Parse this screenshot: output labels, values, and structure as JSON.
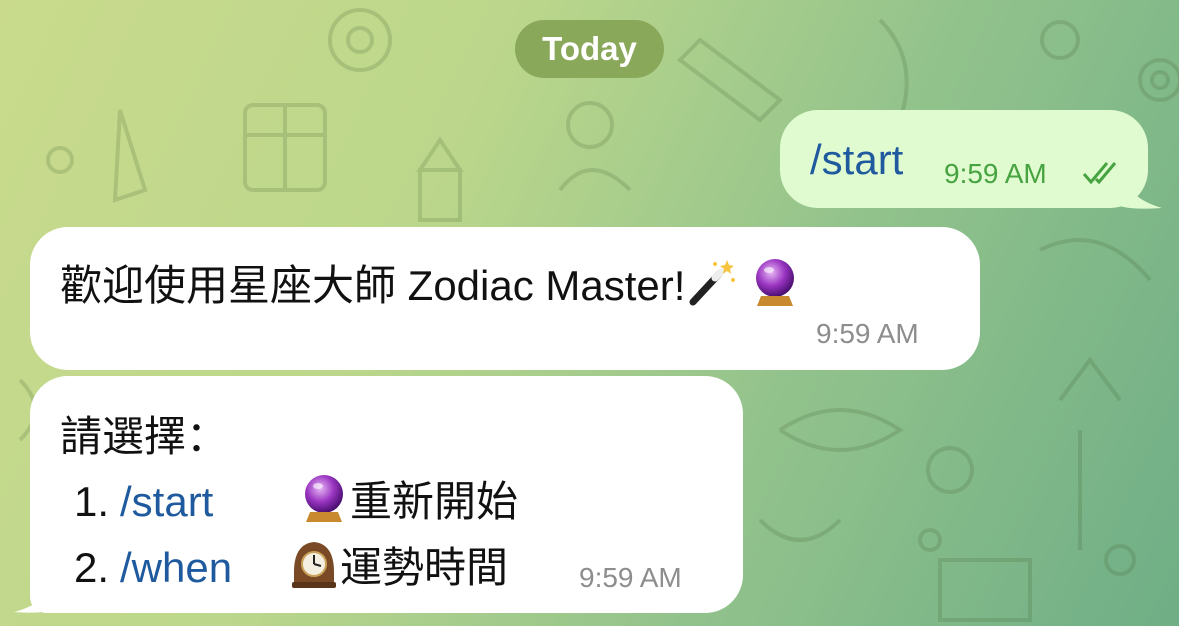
{
  "chat": {
    "date_label": "Today",
    "outgoing": {
      "text": "/start",
      "time": "9:59 AM",
      "status": "read-double-check"
    },
    "incoming_welcome": {
      "text": "歡迎使用星座大師 Zodiac Master!",
      "time": "9:59 AM",
      "emojis": [
        "magic-wand",
        "crystal-ball"
      ]
    },
    "incoming_menu": {
      "title": "請選擇：",
      "time": "9:59 AM",
      "items": [
        {
          "number": "1.",
          "command": "/start",
          "emoji": "crystal-ball",
          "label": "重新開始"
        },
        {
          "number": "2.",
          "command": "/when",
          "emoji": "mantelpiece-clock",
          "label": "運勢時間"
        }
      ]
    }
  },
  "colors": {
    "outgoing_bubble": "#e1fbd1",
    "incoming_bubble": "#ffffff",
    "link": "#1f5a9e",
    "outgoing_time": "#47a340",
    "incoming_time": "#8d8d8d",
    "date_pill": "#8aa85a"
  }
}
